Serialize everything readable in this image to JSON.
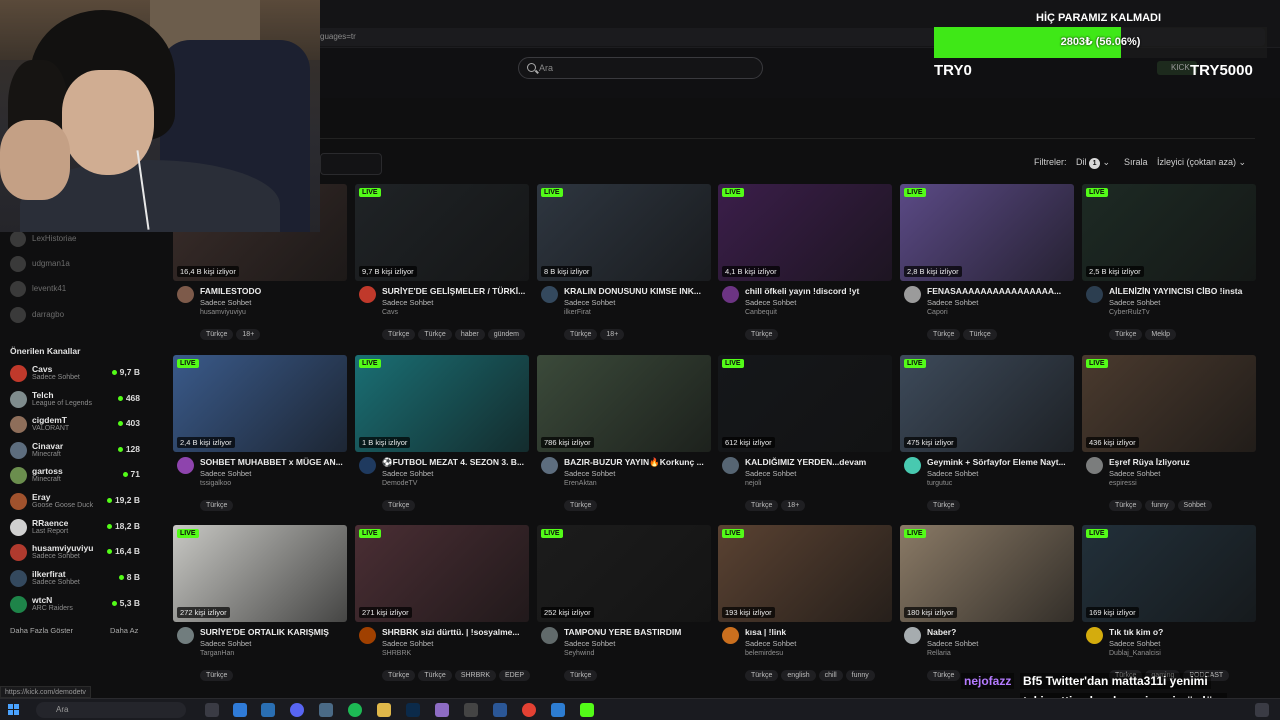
{
  "browser": {
    "url_fragment": "guages=tr"
  },
  "search": {
    "placeholder": "Ara"
  },
  "filters": {
    "label": "Filtreler:",
    "lang": "Dil",
    "lang_count": "1",
    "sort_label": "Sırala",
    "sort_value": "İzleyici (çoktan aza)"
  },
  "sidebar": {
    "dim_items": [
      "LexHistoriae",
      "udgman1a",
      "leventk41",
      "darragbo"
    ],
    "title": "Önerilen Kanallar",
    "channels": [
      {
        "name": "Cavs",
        "game": "Sadece Sohbet",
        "viewers": "9,7 B",
        "color": "#c0392b"
      },
      {
        "name": "Telch",
        "game": "League of Legends",
        "viewers": "468",
        "color": "#7f8c8d"
      },
      {
        "name": "cigdemT",
        "game": "VALORANT",
        "viewers": "403",
        "color": "#8e6e5a"
      },
      {
        "name": "Cinavar",
        "game": "Minecraft",
        "viewers": "128",
        "color": "#5d6d7e"
      },
      {
        "name": "gartoss",
        "game": "Minecraft",
        "viewers": "71",
        "color": "#6b8e4e"
      },
      {
        "name": "Eray",
        "game": "Goose Goose Duck",
        "viewers": "19,2 B",
        "color": "#a0522d"
      },
      {
        "name": "RRaence",
        "game": "Last Report",
        "viewers": "18,2 B",
        "color": "#d0d0d0"
      },
      {
        "name": "husamviyuviyu",
        "game": "Sadece Sohbet",
        "viewers": "16,4 B",
        "color": "#b03a2e"
      },
      {
        "name": "ilkerfirat",
        "game": "Sadece Sohbet",
        "viewers": "8 B",
        "color": "#34495e"
      },
      {
        "name": "wtcN",
        "game": "ARC Raiders",
        "viewers": "5,3 B",
        "color": "#1e8449"
      }
    ],
    "more_label": "Daha Fazla Göster",
    "less_label": "Daha Az"
  },
  "goal": {
    "title": "HİÇ PARAMIZ KALMADI",
    "progress_text": "2803₺ (56.06%)",
    "progress_fraction": 0.5606,
    "left_label": "TRY0",
    "right_label": "TRY5000",
    "kick_label": "KICK"
  },
  "chat": {
    "user": "nejofazz",
    "line1": "Bf5 Twitter'dan matta311i yenimi",
    "line2": "takip etti yoksa benmi yeni gördüm"
  },
  "status_url": "https://kick.com/demodetv",
  "taskbar": {
    "search_label": "Ara"
  },
  "streams": [
    {
      "title": "FAMILESTODO",
      "category": "Sadece Sohbet",
      "channel": "husamviyuviyu",
      "viewers": "16,4 B kişi izliyor",
      "live": false,
      "tags": [
        "Türkçe",
        "18+"
      ],
      "bg": "#3a2d2a",
      "av": "#7d5a4a"
    },
    {
      "title": "SURİYE'DE GELİŞMELER / TÜRKİ...",
      "category": "Sadece Sohbet",
      "channel": "Cavs",
      "viewers": "9,7 B kişi izliyor",
      "live": true,
      "tags": [
        "Türkçe",
        "Türkçe",
        "haber",
        "gündem"
      ],
      "bg": "#1f2326",
      "av": "#c0392b"
    },
    {
      "title": "KRALIN DONUSUNU KIMSE INK...",
      "category": "Sadece Sohbet",
      "channel": "ilkerFirat",
      "viewers": "8 B kişi izliyor",
      "live": true,
      "tags": [
        "Türkçe",
        "18+"
      ],
      "bg": "#2e3640",
      "av": "#34495e"
    },
    {
      "title": "chill öfkeli yayın !discord !yt",
      "category": "Sadece Sohbet",
      "channel": "Canbequit",
      "viewers": "4,1 B kişi izliyor",
      "live": true,
      "tags": [
        "Türkçe"
      ],
      "bg": "#3b1e4a",
      "av": "#6c3483"
    },
    {
      "title": "FENASAAAAAAAAAAAAAAAA...",
      "category": "Sadece Sohbet",
      "channel": "Capori",
      "viewers": "2,8 B kişi izliyor",
      "live": true,
      "tags": [
        "Türkçe",
        "Türkçe"
      ],
      "bg": "#5b4a86",
      "av": "#9b9b9b"
    },
    {
      "title": "AİLENİZİN YAYINCISI CİBO !insta",
      "category": "Sadece Sohbet",
      "channel": "CyberRulzTv",
      "viewers": "2,5 B kişi izliyor",
      "live": true,
      "tags": [
        "Türkçe",
        "Meklp"
      ],
      "bg": "#1d2a24",
      "av": "#2c3e50"
    },
    {
      "title": "SOHBET MUHABBET x MÜGE AN...",
      "category": "Sadece Sohbet",
      "channel": "tssigalkoo",
      "viewers": "2,4 B kişi izliyor",
      "live": true,
      "tags": [
        "Türkçe"
      ],
      "bg": "#3a5a8a",
      "av": "#8e44ad"
    },
    {
      "title": "⚽FUTBOL MEZAT 4. SEZON 3. B...",
      "category": "Sadece Sohbet",
      "channel": "DemodeTV",
      "viewers": "1 B kişi izliyor",
      "live": true,
      "tags": [
        "Türkçe"
      ],
      "bg": "#1a6f74",
      "av": "#1f3a5f"
    },
    {
      "title": "BAZIR-BUZUR YAYIN🔥Korkunç ...",
      "category": "Sadece Sohbet",
      "channel": "ErenAktan",
      "viewers": "786 kişi izliyor",
      "live": false,
      "tags": [
        "Türkçe"
      ],
      "bg": "#3b4a3a",
      "av": "#5d6d7e"
    },
    {
      "title": "KALDIĞIMIZ YERDEN...devam",
      "category": "Sadece Sohbet",
      "channel": "nejoli",
      "viewers": "612 kişi izliyor",
      "live": true,
      "tags": [
        "Türkçe",
        "18+"
      ],
      "bg": "#15171a",
      "av": "#566573"
    },
    {
      "title": "Geymink + Sörfayfor Eleme Nayt...",
      "category": "Sadece Sohbet",
      "channel": "turgutuc",
      "viewers": "475 kişi izliyor",
      "live": true,
      "tags": [
        "Türkçe"
      ],
      "bg": "#3d4a5a",
      "av": "#48c9b0"
    },
    {
      "title": "Eşref Rüya İzliyoruz",
      "category": "Sadece Sohbet",
      "channel": "espiressi",
      "viewers": "436 kişi izliyor",
      "live": true,
      "tags": [
        "Türkçe",
        "funny",
        "Sohbet"
      ],
      "bg": "#4a3a2e",
      "av": "#7b7d7d"
    },
    {
      "title": "SURİYE'DE ORTALIK KARIŞMIŞ",
      "category": "Sadece Sohbet",
      "channel": "TarganHan",
      "viewers": "272 kişi izliyor",
      "live": true,
      "tags": [
        "Türkçe"
      ],
      "bg": "#c8c8c4",
      "av": "#717d7e"
    },
    {
      "title": "SHRBRK sizi dürttü. | !sosyalme...",
      "category": "Sadece Sohbet",
      "channel": "SHRBRK",
      "viewers": "271 kişi izliyor",
      "live": true,
      "tags": [
        "Türkçe",
        "Türkçe",
        "SHRBRK",
        "EDEP"
      ],
      "bg": "#4a2e34",
      "av": "#a04000"
    },
    {
      "title": "TAMPONU YERE BASTIRDIM",
      "category": "Sadece Sohbet",
      "channel": "Seyhwind",
      "viewers": "252 kişi izliyor",
      "live": true,
      "tags": [
        "Türkçe"
      ],
      "bg": "#1c1c1c",
      "av": "#616a6b"
    },
    {
      "title": "kısa | !link",
      "category": "Sadece Sohbet",
      "channel": "belemirdesu",
      "viewers": "193 kişi izliyor",
      "live": true,
      "tags": [
        "Türkçe",
        "english",
        "chill",
        "funny"
      ],
      "bg": "#5a4232",
      "av": "#ca6f1e"
    },
    {
      "title": "Naber?",
      "category": "Sadece Sohbet",
      "channel": "Rellaria",
      "viewers": "180 kişi izliyor",
      "live": true,
      "tags": [
        "Türkçe"
      ],
      "bg": "#8a7a66",
      "av": "#a6acaf"
    },
    {
      "title": "Tık tık kim o?",
      "category": "Sadece Sohbet",
      "channel": "Dublaj_Kanalcisi",
      "viewers": "169 kişi izliyor",
      "live": true,
      "tags": [
        "Türkçe",
        "gaming",
        "PODCAST"
      ],
      "bg": "#22303a",
      "av": "#d4ac0d"
    }
  ]
}
